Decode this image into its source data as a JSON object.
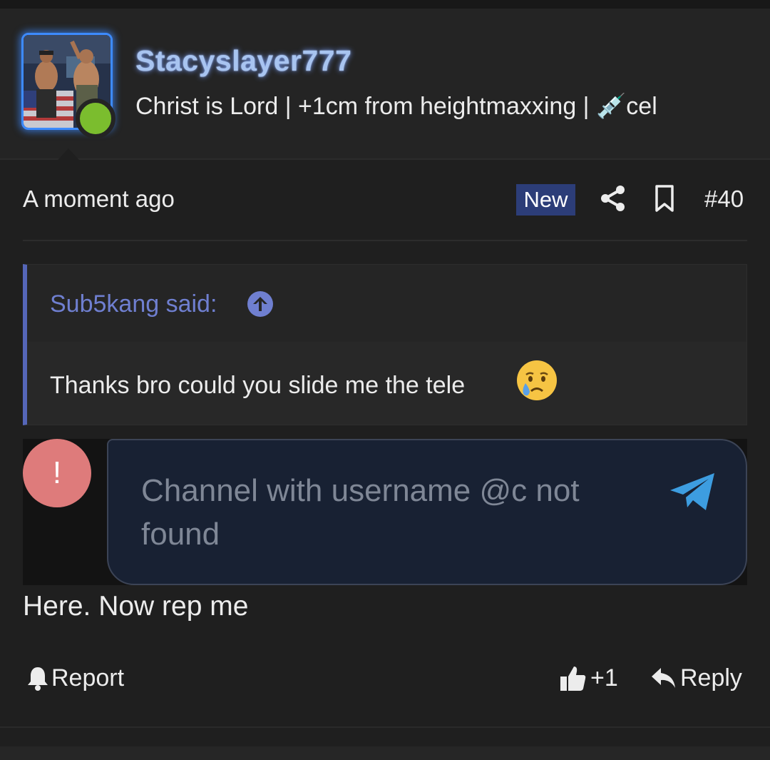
{
  "post": {
    "author": {
      "username": "Stacyslayer777",
      "title_text": "Christ is Lord | +1cm from heightmaxxing | ",
      "title_emoji": "💉",
      "title_suffix": "cel",
      "online_status": "online",
      "avatar_icon": "avatar-photo"
    },
    "meta": {
      "time": "A moment ago",
      "new_badge": "New",
      "post_number": "#40",
      "share_icon": "share-icon",
      "bookmark_icon": "bookmark-icon"
    },
    "quote": {
      "author_line": "Sub5kang said:",
      "text": "Thanks bro could you slide me the tele",
      "emoji": "crying-face"
    },
    "telegram_embed": {
      "error_symbol": "!",
      "message": "Channel with username @c not found",
      "send_icon": "telegram-plane-icon"
    },
    "body": "Here. Now rep me",
    "actions": {
      "report_label": "Report",
      "like_label": "+1",
      "reply_label": "Reply"
    }
  },
  "colors": {
    "background": "#1f1f1f",
    "header_bg": "#242424",
    "username_glow": "#a8c4f0",
    "online": "#7bbd2e",
    "new_badge_bg": "#2c3d78",
    "quote_accent": "#5566b8",
    "quote_author": "#6f7fd0",
    "tg_bubble": "#182133",
    "tg_send": "#3d9de0",
    "error": "#de7b7b"
  }
}
